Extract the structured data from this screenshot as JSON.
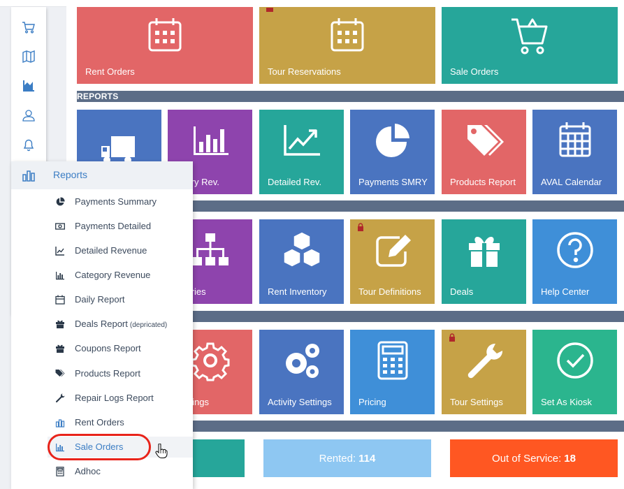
{
  "colors": {
    "red": "#e26667",
    "gold": "#c6a247",
    "teal": "#26a69a",
    "blue": "#4a74c0",
    "purple": "#8e44ad",
    "sky": "#3f8fd8",
    "green": "#2bb58e",
    "section": "#5c6d87",
    "accent": "#3b7dc4"
  },
  "tiles": {
    "rent_orders": "Rent Orders",
    "tour_reservations": "Tour Reservations",
    "sale_orders": "Sale Orders",
    "category_rev": "egory Rev.",
    "detailed_rev": "Detailed Rev.",
    "payments_smry": "Payments SMRY",
    "products_report": "Products Report",
    "aval_calendar": "AVAL Calendar",
    "categories": "egories",
    "rent_inventory": "Rent Inventory",
    "tour_definitions": "Tour Definitions",
    "deals": "Deals",
    "help_center": "Help Center",
    "settings": "Settings",
    "activity_settings": "Activity Settings",
    "pricing": "Pricing",
    "tour_settings": "Tour Settings",
    "set_as_kiosk": "Set As Kiosk"
  },
  "sections": {
    "reports": "REPORTS"
  },
  "status": {
    "rented_label": "Rented:",
    "rented_value": "114",
    "out_label": "Out of Service:",
    "out_value": "18"
  },
  "sidebar": {
    "icons": [
      "cart-icon",
      "map-icon",
      "chart-area-icon",
      "users-icon",
      "bell-icon",
      "bar-chart-icon",
      "id-card-icon",
      "lifebuoy-icon",
      "gear-icon",
      "sign-out-icon"
    ]
  },
  "flyout": {
    "title": "Reports",
    "items": [
      {
        "label": "Payments Summary",
        "icon": "pie-chart-icon"
      },
      {
        "label": "Payments Detailed",
        "icon": "money-icon"
      },
      {
        "label": "Detailed Revenue",
        "icon": "line-chart-icon"
      },
      {
        "label": "Category Revenue",
        "icon": "bar-chart-icon"
      },
      {
        "label": "Daily Report",
        "icon": "calendar-icon"
      },
      {
        "label": "Deals Report",
        "small": "(depricated)",
        "icon": "gift-icon"
      },
      {
        "label": "Coupons Report",
        "icon": "gift-icon"
      },
      {
        "label": "Products Report",
        "icon": "tags-icon"
      },
      {
        "label": "Repair Logs Report",
        "icon": "wrench-icon"
      },
      {
        "label": "Rent Orders",
        "icon": "bar-chart-icon"
      },
      {
        "label": "Sale Orders",
        "icon": "bar-chart-icon"
      },
      {
        "label": "Adhoc",
        "icon": "calculator-icon"
      }
    ]
  }
}
